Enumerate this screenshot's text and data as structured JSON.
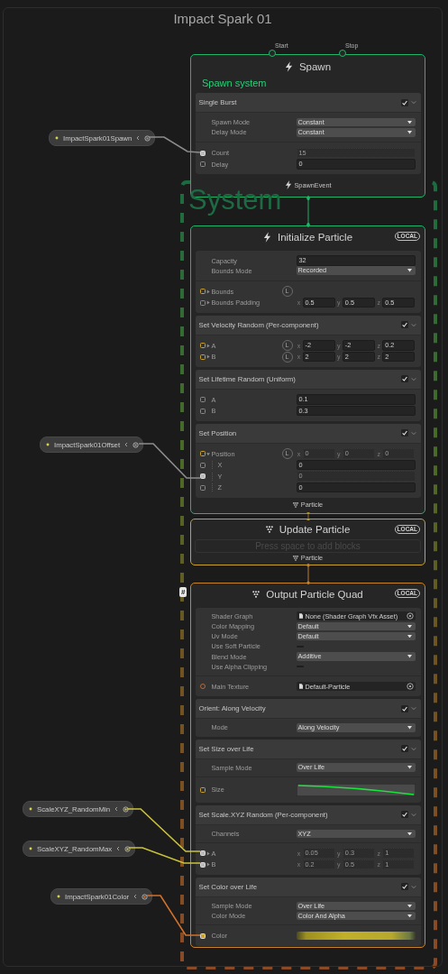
{
  "graph": {
    "title": "Impact Spark 01",
    "system_label": "System"
  },
  "parameters": [
    {
      "name": "ImpactSpark01Spawn",
      "color": "#8c8c8c"
    },
    {
      "name": "ImpactSpark01Offset",
      "color": "#8c8c8c"
    },
    {
      "name": "ScaleXYZ_RandomMin",
      "color": "#c9c23a"
    },
    {
      "name": "ScaleXYZ_RandomMax",
      "color": "#c9c23a"
    },
    {
      "name": "ImpactSpark01Color",
      "color": "#d2702c"
    }
  ],
  "contexts": [
    {
      "kind": "spawn",
      "title": "Spawn",
      "color": "#22b56a",
      "ports": [
        {
          "label": "Start"
        },
        {
          "label": "Stop"
        }
      ],
      "subtitle": "Spawn system",
      "blocks": [
        {
          "title": "Single Burst",
          "enabled": true,
          "settings": [
            {
              "label": "Spawn Mode",
              "kind": "dropdown",
              "value": "Constant"
            },
            {
              "label": "Delay Mode",
              "kind": "dropdown",
              "value": "Constant"
            }
          ],
          "properties": [
            {
              "label": "Count",
              "kind": "float",
              "value": "15",
              "linked": true
            },
            {
              "label": "Delay",
              "kind": "float",
              "value": "0",
              "linked": false
            }
          ]
        }
      ],
      "footer": "SpawnEvent"
    },
    {
      "kind": "initialize",
      "title": "Initialize Particle",
      "color": "#22b56a",
      "badge": "LOCAL",
      "settings": [
        {
          "label": "Capacity",
          "kind": "text",
          "value": "32"
        },
        {
          "label": "Bounds Mode",
          "kind": "dropdown",
          "value": "Recorded"
        }
      ],
      "properties": [
        {
          "label": "Bounds",
          "kind": "none",
          "linked": false,
          "expanded": false,
          "space": "L"
        },
        {
          "label": "Bounds Padding",
          "kind": "vector3",
          "linked": false,
          "expanded": false,
          "components": [
            {
              "axis": "x",
              "value": "0.5"
            },
            {
              "axis": "y",
              "value": "0.5"
            },
            {
              "axis": "z",
              "value": "0.5"
            }
          ]
        }
      ],
      "blocks": [
        {
          "title": "Set Velocity Random (Per-component)",
          "enabled": true,
          "properties": [
            {
              "label": "A",
              "kind": "vector3",
              "linked": false,
              "expanded": false,
              "space": "L",
              "components": [
                {
                  "axis": "x",
                  "value": "-2"
                },
                {
                  "axis": "y",
                  "value": "-2"
                },
                {
                  "axis": "z",
                  "value": "0.2"
                }
              ]
            },
            {
              "label": "B",
              "kind": "vector3",
              "linked": false,
              "expanded": false,
              "space": "L",
              "components": [
                {
                  "axis": "x",
                  "value": "2"
                },
                {
                  "axis": "y",
                  "value": "2"
                },
                {
                  "axis": "z",
                  "value": "2"
                }
              ]
            }
          ]
        },
        {
          "title": "Set Lifetime Random (Uniform)",
          "enabled": true,
          "properties": [
            {
              "label": "A",
              "kind": "float",
              "value": "0.1",
              "linked": false
            },
            {
              "label": "B",
              "kind": "float",
              "value": "0.3",
              "linked": false
            }
          ]
        },
        {
          "title": "Set Position",
          "enabled": true,
          "properties": [
            {
              "label": "Position",
              "kind": "vector3",
              "linked": false,
              "expanded": true,
              "space": "L",
              "components": [
                {
                  "axis": "x",
                  "value": "0"
                },
                {
                  "axis": "y",
                  "value": "0"
                },
                {
                  "axis": "z",
                  "value": "0"
                }
              ],
              "children": [
                {
                  "label": "X",
                  "kind": "float",
                  "value": "0",
                  "linked": false
                },
                {
                  "label": "Y",
                  "kind": "float",
                  "value": "0",
                  "linked": true
                },
                {
                  "label": "Z",
                  "kind": "float",
                  "value": "0",
                  "linked": false
                }
              ]
            }
          ]
        }
      ],
      "footer": "Particle"
    },
    {
      "kind": "update",
      "title": "Update Particle",
      "color": "#c9a227",
      "badge": "LOCAL",
      "empty_hint": "Press space to add blocks",
      "footer": "Particle"
    },
    {
      "kind": "output",
      "title": "Output Particle Quad",
      "color": "#c9842a",
      "badge": "LOCAL",
      "flag": "#",
      "settings": [
        {
          "label": "Shader Graph",
          "kind": "object",
          "value": "None (Shader Graph Vfx Asset)"
        },
        {
          "label": "Color Mapping",
          "kind": "dropdown",
          "value": "Default"
        },
        {
          "label": "Uv Mode",
          "kind": "dropdown",
          "value": "Default"
        },
        {
          "label": "Use Soft Particle",
          "kind": "toggle",
          "on": false
        },
        {
          "label": "Blend Mode",
          "kind": "dropdown",
          "value": "Additive"
        },
        {
          "label": "Use Alpha Clipping",
          "kind": "toggle",
          "on": false
        }
      ],
      "properties": [
        {
          "label": "Main Texture",
          "kind": "object",
          "value": "Default-Particle",
          "linked": false
        }
      ],
      "blocks": [
        {
          "title": "Orient: Along Velocity",
          "enabled": true,
          "settings": [
            {
              "label": "Mode",
              "kind": "dropdown",
              "value": "Along Velocity"
            }
          ]
        },
        {
          "title": "Set Size over Life",
          "enabled": true,
          "settings": [
            {
              "label": "Sample Mode",
              "kind": "dropdown",
              "value": "Over Life"
            }
          ],
          "properties": [
            {
              "label": "Size",
              "kind": "curve",
              "linked": false
            }
          ]
        },
        {
          "title": "Set Scale.XYZ Random (Per-component)",
          "enabled": true,
          "settings": [
            {
              "label": "Channels",
              "kind": "dropdown",
              "value": "XYZ"
            }
          ],
          "properties": [
            {
              "label": "A",
              "kind": "vector3",
              "linked": true,
              "expanded": false,
              "components": [
                {
                  "axis": "x",
                  "value": "0.05"
                },
                {
                  "axis": "y",
                  "value": "0.3"
                },
                {
                  "axis": "z",
                  "value": "1"
                }
              ]
            },
            {
              "label": "B",
              "kind": "vector3",
              "linked": true,
              "expanded": false,
              "components": [
                {
                  "axis": "x",
                  "value": "0.2"
                },
                {
                  "axis": "y",
                  "value": "0.5"
                },
                {
                  "axis": "z",
                  "value": "1"
                }
              ]
            }
          ]
        },
        {
          "title": "Set Color over Life",
          "enabled": true,
          "settings": [
            {
              "label": "Sample Mode",
              "kind": "dropdown",
              "value": "Over Life"
            },
            {
              "label": "Color Mode",
              "kind": "dropdown",
              "value": "Color And Alpha"
            }
          ],
          "properties": [
            {
              "label": "Color",
              "kind": "gradient",
              "linked": true
            }
          ]
        }
      ]
    }
  ]
}
